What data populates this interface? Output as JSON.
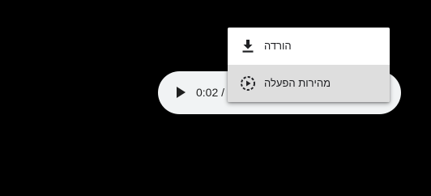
{
  "player": {
    "play_icon": "play-icon",
    "time_text": "0:02 /"
  },
  "menu": {
    "items": [
      {
        "label": "הורדה",
        "icon": "download-icon",
        "highlighted": false
      },
      {
        "label": "מהירות הפעלה",
        "icon": "playback-speed-icon",
        "highlighted": true
      }
    ]
  },
  "colors": {
    "background": "#000000",
    "player_bg": "#f1f3f4",
    "menu_bg": "#ffffff",
    "menu_highlight": "#dedede",
    "text": "#202124"
  }
}
